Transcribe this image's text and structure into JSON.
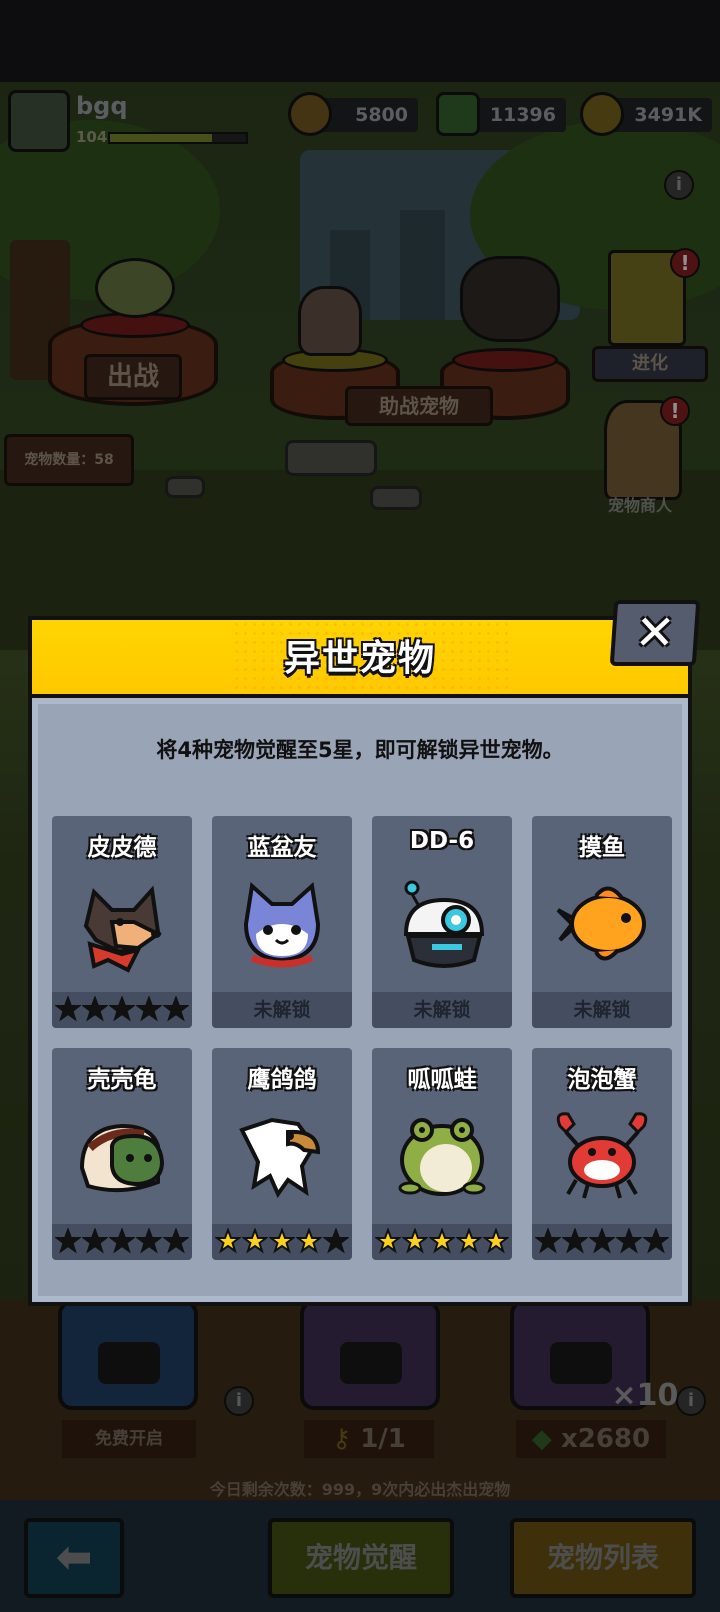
{
  "hud": {
    "player_name": "bgq",
    "player_level": "104",
    "xp_fraction": 0.75,
    "resources": [
      {
        "name": "coin",
        "value": "5800"
      },
      {
        "name": "gem",
        "value": "11396"
      },
      {
        "name": "gold",
        "value": "3491K"
      }
    ]
  },
  "scene": {
    "battle_label": "出战",
    "assist_label": "助战宠物",
    "pet_count_label": "宠物数量：58",
    "evolve_label": "进化",
    "merchant_label": "宠物商人",
    "free_open_label": "免费开启",
    "keys_label": "1/1",
    "multiplier_label": "×10",
    "gem_cost_label": "x2680",
    "daily_remaining": "今日剩余次数：999，9次内必出杰出宠物"
  },
  "bottom_nav": {
    "back_icon": "arrow-left-icon",
    "awaken_label": "宠物觉醒",
    "list_label": "宠物列表"
  },
  "modal": {
    "title": "异世宠物",
    "description": "将4种宠物觉醒至5星，即可解锁异世宠物。",
    "close_icon": "close-icon",
    "locked_text": "未解锁",
    "pets": [
      {
        "name": "皮皮德",
        "icon": "dog-icon",
        "status": "stars",
        "gold_stars": 0
      },
      {
        "name": "蓝盆友",
        "icon": "cat-icon",
        "status": "locked"
      },
      {
        "name": "DD-6",
        "icon": "robot-icon",
        "status": "locked"
      },
      {
        "name": "摸鱼",
        "icon": "goldfish-icon",
        "status": "locked"
      },
      {
        "name": "壳壳龟",
        "icon": "turtle-icon",
        "status": "stars",
        "gold_stars": 0
      },
      {
        "name": "鹰鸽鸽",
        "icon": "eagle-icon",
        "status": "stars",
        "gold_stars": 4
      },
      {
        "name": "呱呱蛙",
        "icon": "frog-icon",
        "status": "stars",
        "gold_stars": 5
      },
      {
        "name": "泡泡蟹",
        "icon": "crab-icon",
        "status": "stars",
        "gold_stars": 0
      }
    ]
  },
  "colors": {
    "header_yellow": "#ffd400",
    "panel_gray": "#9aa4b7",
    "card_bg": "#5a6478",
    "star_gold": "#ffd21a",
    "star_empty": "#111111"
  }
}
